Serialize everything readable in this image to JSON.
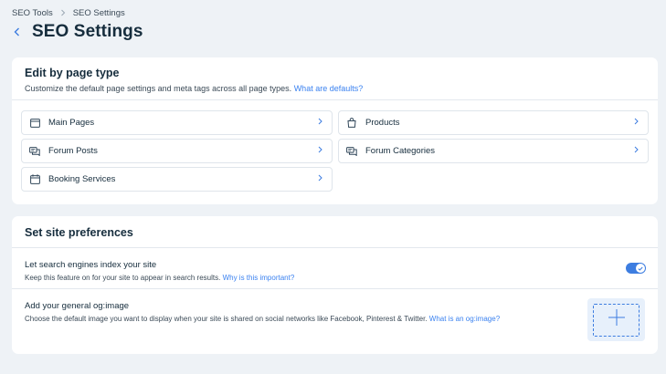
{
  "breadcrumb": {
    "items": [
      "SEO Tools",
      "SEO Settings"
    ]
  },
  "header": {
    "title": "SEO Settings"
  },
  "page_types": {
    "title": "Edit by page type",
    "description": "Customize the default page settings and meta tags across all page types.",
    "link": "What are defaults?",
    "items": [
      {
        "label": "Main Pages",
        "icon": "browser-window-icon"
      },
      {
        "label": "Products",
        "icon": "shopping-bag-icon"
      },
      {
        "label": "Forum Posts",
        "icon": "chat-bubbles-icon"
      },
      {
        "label": "Forum Categories",
        "icon": "chat-bubbles-icon"
      },
      {
        "label": "Booking Services",
        "icon": "calendar-icon"
      }
    ]
  },
  "preferences": {
    "title": "Set site preferences",
    "index": {
      "title": "Let search engines index your site",
      "description": "Keep this feature on for your site to appear in search results.",
      "link": "Why is this important?",
      "enabled": true
    },
    "og_image": {
      "title": "Add your general og:image",
      "description": "Choose the default image you want to display when your site is shared on social networks like Facebook, Pinterest & Twitter.",
      "link": "What is an og:image?"
    }
  },
  "colors": {
    "accent": "#3d7de0",
    "link": "#3b82f0",
    "background": "#eef2f6"
  }
}
